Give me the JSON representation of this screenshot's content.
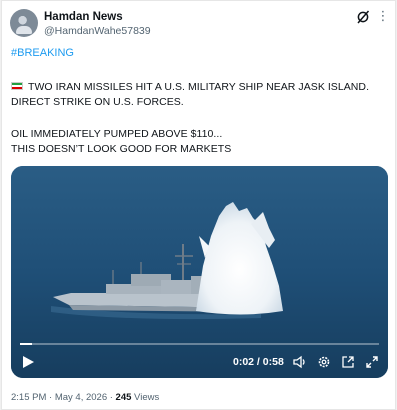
{
  "post": {
    "author_name": "Hamdan News",
    "author_handle": "@HamdanWahe57839",
    "hashtag": "#BREAKING",
    "lines": [
      "TWO IRAN MISSILES HIT A U.S. MILITARY SHIP NEAR JASK ISLAND.",
      "DIRECT STRIKE ON U.S. FORCES.",
      "OIL IMMEDIATELY PUMPED ABOVE $110...",
      "THIS DOESN’T LOOK GOOD FOR MARKETS"
    ],
    "flag_icon": "iran-flag-icon",
    "timestamp": "2:15 PM · May 4, 2026 · ",
    "views_count": "245",
    "views_label": " Views"
  },
  "video": {
    "time_display": "0:02 / 0:58",
    "progress_fraction": 0.034,
    "icons": [
      "play-icon",
      "volume-icon",
      "settings-icon",
      "pip-icon",
      "fullscreen-icon"
    ]
  },
  "header_icons": [
    "grok-icon",
    "more-icon"
  ],
  "colors": {
    "link": "#1d9bf0",
    "secondary_text": "#536471",
    "sea": "#1e4e73"
  }
}
